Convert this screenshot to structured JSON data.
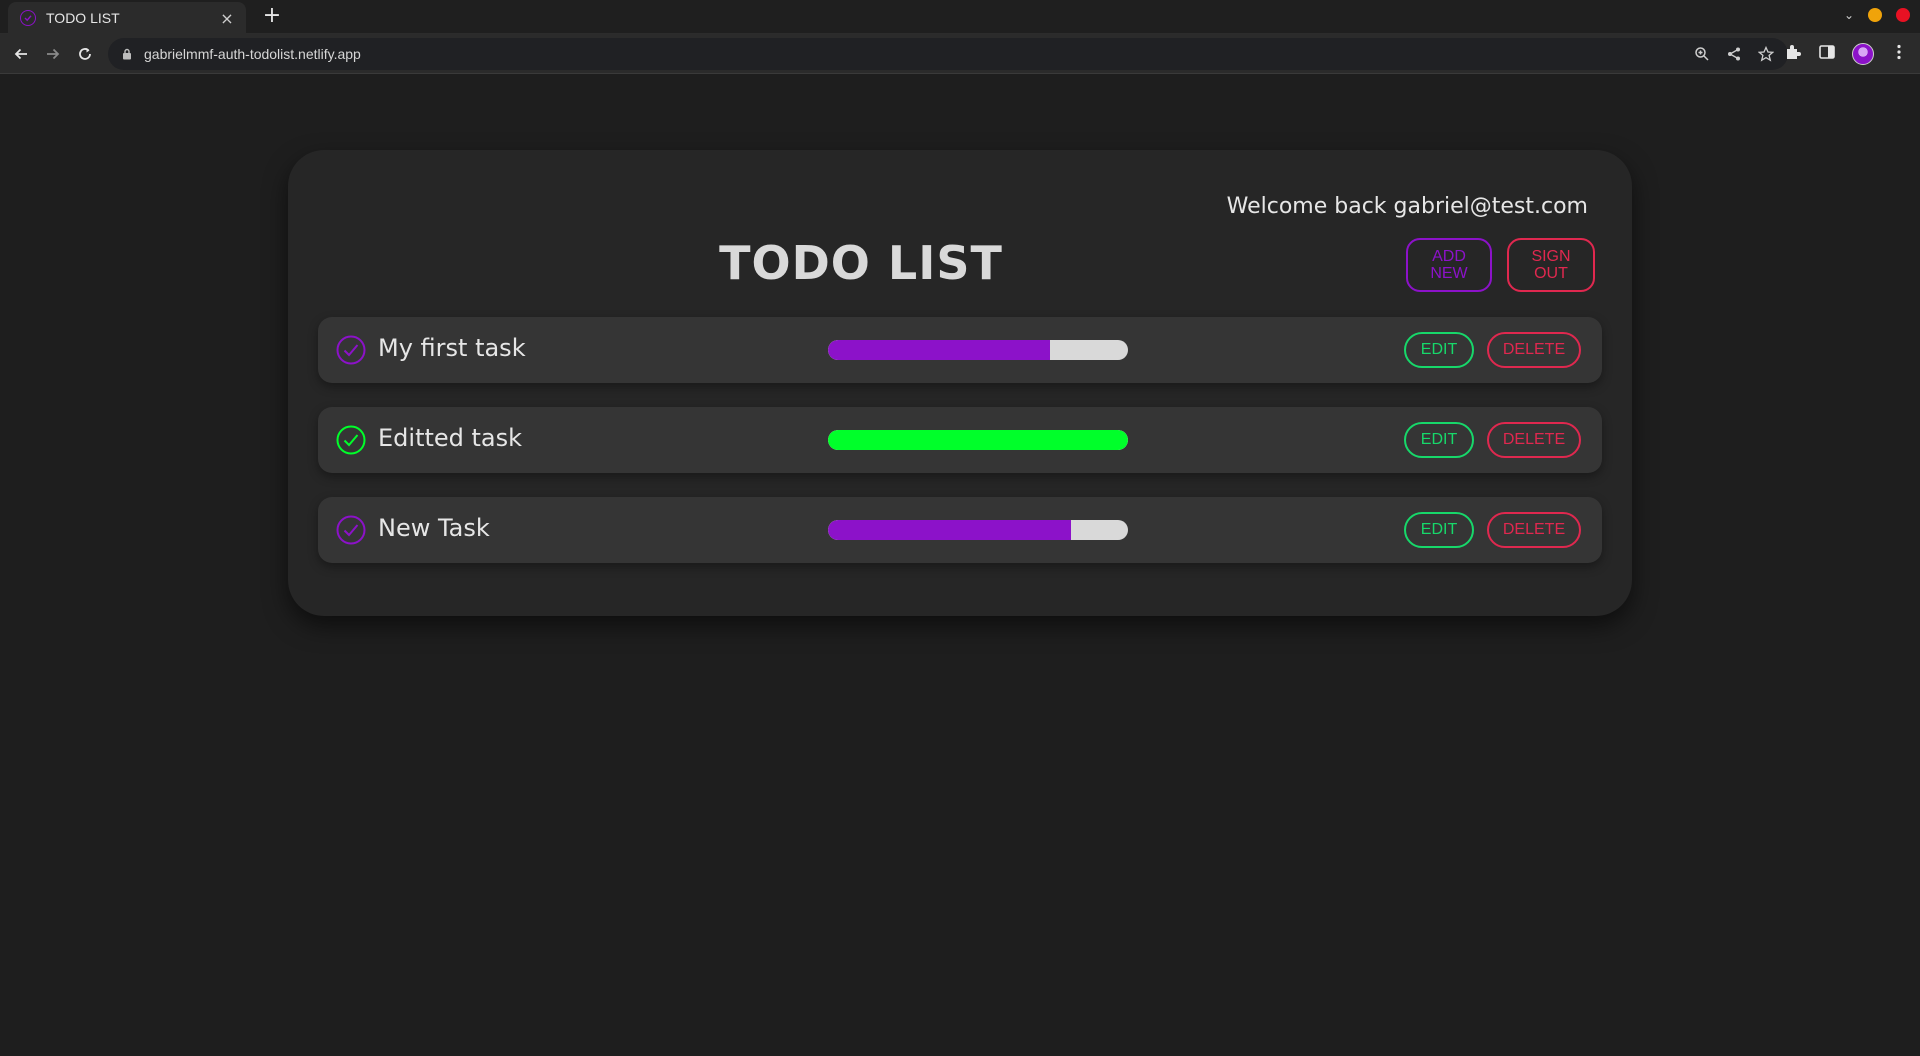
{
  "browser": {
    "tab_title": "TODO LIST",
    "tab_close": "×",
    "new_tab": "+",
    "url": "gabrielmmf-auth-todolist.netlify.app",
    "window_dots": {
      "minimize": "#f0a30a",
      "close": "#e81123"
    },
    "icons": [
      "favicon-check-icon",
      "back-icon",
      "forward-icon",
      "reload-icon",
      "lock-icon",
      "zoom-icon",
      "share-icon",
      "star-icon",
      "extensions-icon",
      "sidepanel-icon",
      "avatar",
      "menu-icon"
    ]
  },
  "app": {
    "welcome": "Welcome back gabriel@test.com",
    "title": "TODO LIST",
    "add_new_line1": "ADD",
    "add_new_line2": "NEW",
    "sign_out_line1": "SIGN",
    "sign_out_line2": "OUT",
    "colors": {
      "accent": "#8c12c9",
      "complete": "#00ff2a",
      "edit": "#17d86a",
      "danger": "#e0284f"
    }
  },
  "tasks": [
    {
      "title": "My first task",
      "progress": 0.74,
      "complete": false,
      "edit_label": "EDIT",
      "delete_label": "DELETE"
    },
    {
      "title": "Editted task",
      "progress": 1.0,
      "complete": true,
      "edit_label": "EDIT",
      "delete_label": "DELETE"
    },
    {
      "title": "New Task",
      "progress": 0.81,
      "complete": false,
      "edit_label": "EDIT",
      "delete_label": "DELETE"
    }
  ]
}
